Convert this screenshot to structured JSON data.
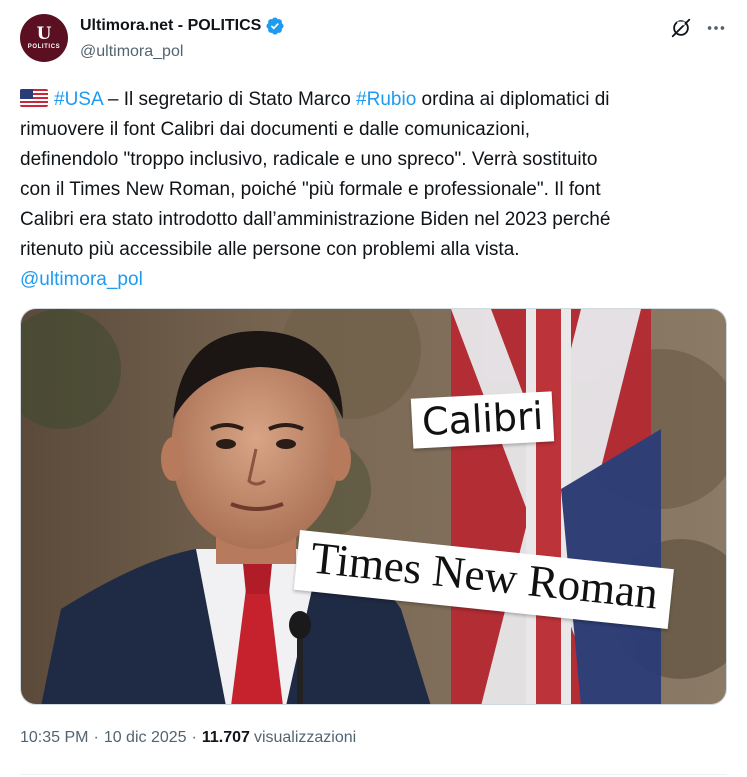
{
  "header": {
    "avatar_mark": "U",
    "avatar_sub": "POLITICS",
    "display_name": "Ultimora.net - POLITICS",
    "handle": "@ultimora_pol"
  },
  "icons": {
    "verified": "verified-badge-icon",
    "grok": "grok-icon",
    "more": "more-icon",
    "flag": "us-flag-icon"
  },
  "tweet": {
    "line1": {
      "hashtag1": "#USA",
      "text1": " – Il segretario di Stato Marco ",
      "hashtag2": "#Rubio",
      "text2": " ordina ai diplomatici di"
    },
    "line2": "rimuovere il font Calibri dai documenti e dalle comunicazioni,",
    "line3": "definendolo \"troppo inclusivo, radicale e uno spreco\". Verrà sostituito",
    "line4": "con il Times New Roman, poiché \"più formale e professionale\". Il font",
    "line5": "Calibri era stato introdotto dall’amministrazione Biden nel 2023 perché",
    "line6": "ritenuto più accessibile alle persone con problemi alla vista.",
    "mention": "@ultimora_pol"
  },
  "media": {
    "label_calibri": "Calibri",
    "label_times": "Times New Roman"
  },
  "meta": {
    "time": "10:35 PM",
    "separator": "·",
    "date": "10 dic 2025",
    "views_count": "11.707",
    "views_label": "visualizzazioni"
  },
  "colors": {
    "link": "#1d9bf0",
    "text": "#0f1419",
    "secondary": "#536471",
    "avatar_bg": "#5a1020"
  }
}
